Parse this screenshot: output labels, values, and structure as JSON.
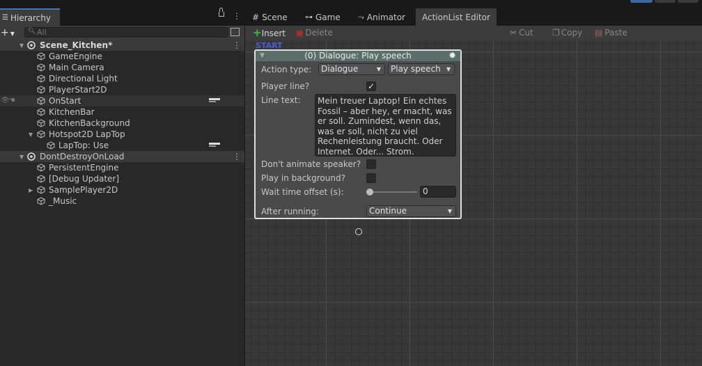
{
  "hierarchy": {
    "tab_title": "Hierarchy",
    "search_placeholder": "All",
    "rows": [
      {
        "label": "Scene_Kitchen*",
        "kind": "scene"
      },
      {
        "label": "GameEngine"
      },
      {
        "label": "Main Camera"
      },
      {
        "label": "Directional Light"
      },
      {
        "label": "PlayerStart2D"
      },
      {
        "label": "OnStart"
      },
      {
        "label": "KitchenBar"
      },
      {
        "label": "KitchenBackground"
      },
      {
        "label": "Hotspot2D LapTop"
      },
      {
        "label": "LapTop: Use"
      },
      {
        "label": "DontDestroyOnLoad",
        "kind": "scene"
      },
      {
        "label": "PersistentEngine"
      },
      {
        "label": "[Debug Updater]"
      },
      {
        "label": "SamplePlayer2D"
      },
      {
        "label": "_Music"
      }
    ]
  },
  "tabs": {
    "scene": "Scene",
    "game": "Game",
    "animator": "Animator",
    "actionlist": "ActionList Editor"
  },
  "toolbar": {
    "insert": "Insert",
    "delete": "Delete",
    "cut": "Cut",
    "copy": "Copy",
    "paste": "Paste"
  },
  "canvas": {
    "start_label": "START"
  },
  "node": {
    "title": "(0) Dialogue: Play speech",
    "action_type_label": "Action type:",
    "action_category": "Dialogue",
    "action_name": "Play speech",
    "player_line_label": "Player line?",
    "player_line_checked": true,
    "line_text_label": "Line text:",
    "line_text": "Mein treuer Laptop! Ein echtes Fossil – aber hey, er macht, was er soll. Zumindest, wenn das, was er soll, nicht zu viel Rechenleistung braucht. Oder Internet. Oder... Strom.",
    "dont_animate_label": "Don't animate speaker?",
    "play_bg_label": "Play in background?",
    "wait_offset_label": "Wait time offset (s):",
    "wait_offset_value": "0",
    "wait_offset_slider": 0,
    "after_running_label": "After running:",
    "after_running_value": "Continue"
  },
  "colors": {
    "accent_blue": "#3a79bb",
    "insert_green": "#3fbf3f",
    "delete_red": "#a03030",
    "start_label": "#4c5cd1",
    "node_header": "#5a6f6a"
  }
}
